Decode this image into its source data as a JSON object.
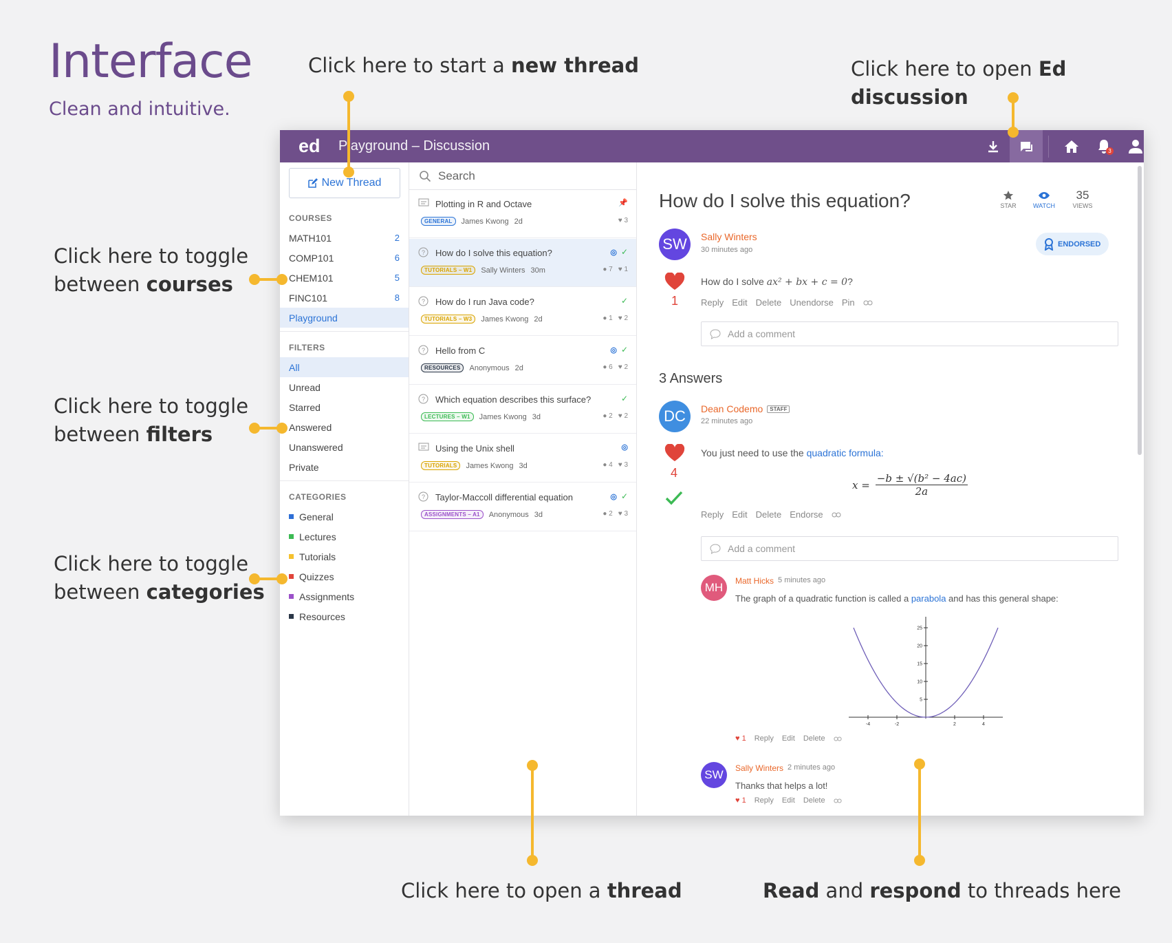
{
  "intro": {
    "title": "Interface",
    "subtitle": "Clean and intuitive."
  },
  "callouts": {
    "new_thread": {
      "pre": "Click here to start a ",
      "bold": "new thread"
    },
    "ed_discussion": {
      "pre": "Click here to open ",
      "bold": "Ed discussion"
    },
    "courses": {
      "line1": "Click here to toggle",
      "pre": "between ",
      "bold": "courses"
    },
    "filters": {
      "line1": "Click here to toggle",
      "pre": "between ",
      "bold": "filters"
    },
    "categories": {
      "line1": "Click here to toggle",
      "pre": "between ",
      "bold": "categories"
    },
    "open_thread": {
      "pre": "Click here to open a ",
      "bold": "thread"
    },
    "read_respond": {
      "b1": "Read",
      "mid": " and ",
      "b2": "respond",
      "post": " to threads here"
    }
  },
  "app": {
    "logo": "ed",
    "title": "Playground – Discussion",
    "notifications_badge": "3",
    "new_thread_label": "New Thread",
    "courses_heading": "COURSES",
    "courses": [
      {
        "name": "MATH101",
        "count": "2"
      },
      {
        "name": "COMP101",
        "count": "6"
      },
      {
        "name": "CHEM101",
        "count": "5"
      },
      {
        "name": "FINC101",
        "count": "8"
      },
      {
        "name": "Playground",
        "count": ""
      }
    ],
    "filters_heading": "FILTERS",
    "filters": [
      "All",
      "Unread",
      "Starred",
      "Answered",
      "Unanswered",
      "Private"
    ],
    "categories_heading": "CATEGORIES",
    "categories": [
      {
        "name": "General",
        "color": "#2e6fd6"
      },
      {
        "name": "Lectures",
        "color": "#3cba54"
      },
      {
        "name": "Tutorials",
        "color": "#f5c12e"
      },
      {
        "name": "Quizzes",
        "color": "#e0443a"
      },
      {
        "name": "Assignments",
        "color": "#9b51c9"
      },
      {
        "name": "Resources",
        "color": "#2a3647"
      }
    ],
    "search_placeholder": "Search",
    "threads": [
      {
        "title": "Plotting in R and Octave",
        "tag": "GENERAL",
        "tag_color": "#2b73d6",
        "author": "James Kwong",
        "time": "2d",
        "comments": "",
        "likes": "3"
      },
      {
        "title": "How do I solve this equation?",
        "tag": "TUTORIALS – W1",
        "tag_color": "#d9a400",
        "author": "Sally Winters",
        "time": "30m",
        "comments": "7",
        "likes": "1"
      },
      {
        "title": "How do I run Java code?",
        "tag": "TUTORIALS – W3",
        "tag_color": "#d9a400",
        "author": "James Kwong",
        "time": "2d",
        "comments": "1",
        "likes": "2"
      },
      {
        "title": "Hello from C",
        "tag": "RESOURCES",
        "tag_color": "#2a3647",
        "author": "Anonymous",
        "time": "2d",
        "comments": "6",
        "likes": "2"
      },
      {
        "title": "Which equation describes this surface?",
        "tag": "LECTURES – W1",
        "tag_color": "#3cba54",
        "author": "James Kwong",
        "time": "3d",
        "comments": "2",
        "likes": "2"
      },
      {
        "title": "Using the Unix shell",
        "tag": "TUTORIALS",
        "tag_color": "#d9a400",
        "author": "James Kwong",
        "time": "3d",
        "comments": "4",
        "likes": "3"
      },
      {
        "title": "Taylor-Maccoll differential equation",
        "tag": "ASSIGNMENTS – A1",
        "tag_color": "#9b51c9",
        "author": "Anonymous",
        "time": "3d",
        "comments": "2",
        "likes": "3"
      }
    ],
    "question": {
      "title": "How do I solve this equation?",
      "star_label": "STAR",
      "watch_label": "WATCH",
      "views": "35",
      "views_label": "VIEWS",
      "author_initials": "SW",
      "author": "Sally Winters",
      "time": "30 minutes ago",
      "endorsed_label": "ENDORSED",
      "body_pre": "How do I solve ",
      "body_math": "ax² + bx + c = 0",
      "body_post": "?",
      "likes": "1",
      "actions": [
        "Reply",
        "Edit",
        "Delete",
        "Unendorse",
        "Pin"
      ],
      "comment_placeholder": "Add a comment"
    },
    "answers_heading": "3 Answers",
    "answer": {
      "author_initials": "DC",
      "author": "Dean Codemo",
      "badge": "STAFF",
      "time": "22 minutes ago",
      "body_pre": "You just need to use the ",
      "body_link": "quadratic formula:",
      "formula_lhs": "x =",
      "formula_num": "−b ± √(b² − 4ac)",
      "formula_den": "2a",
      "likes": "4",
      "actions": [
        "Reply",
        "Edit",
        "Delete",
        "Endorse"
      ],
      "comment_placeholder": "Add a comment"
    },
    "comments": [
      {
        "initials": "MH",
        "author": "Matt Hicks",
        "time": "5 minutes ago",
        "body_pre": "The graph of a quadratic function is called a ",
        "body_link": "parabola",
        "body_post": " and has this general shape:",
        "likes": "1",
        "actions": [
          "Reply",
          "Edit",
          "Delete"
        ]
      },
      {
        "initials": "SW",
        "author": "Sally Winters",
        "time": "2 minutes ago",
        "body": "Thanks that helps a lot!",
        "likes": "1",
        "actions": [
          "Reply",
          "Edit",
          "Delete"
        ]
      }
    ],
    "plot": {
      "x_ticks": [
        "-4",
        "-2",
        "2",
        "4"
      ],
      "y_ticks": [
        "5",
        "10",
        "15",
        "20",
        "25"
      ]
    }
  },
  "colors": {
    "accent": "#6f4f8a",
    "link": "#2b73d6",
    "callout_line": "#f5b82e",
    "heart": "#e0443a",
    "check": "#3cba54"
  }
}
